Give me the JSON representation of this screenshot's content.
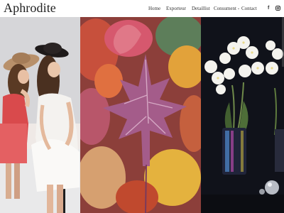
{
  "brand": {
    "name": "Aphrodite"
  },
  "nav": {
    "items": [
      {
        "label": "Home"
      },
      {
        "label": "Exporteur"
      },
      {
        "label": "Detaillist"
      },
      {
        "label": "Consument",
        "has_dropdown": true
      },
      {
        "label": "Contact"
      }
    ]
  },
  "social": {
    "facebook_glyph": "f",
    "instagram_icon": "instagram-icon"
  },
  "panels": [
    {
      "name": "two-women-on-bench-photo"
    },
    {
      "name": "autumn-leaves-photo"
    },
    {
      "name": "white-orchid-vase-photo"
    }
  ],
  "colors": {
    "header_bg": "#ffffff",
    "text": "#333333"
  }
}
